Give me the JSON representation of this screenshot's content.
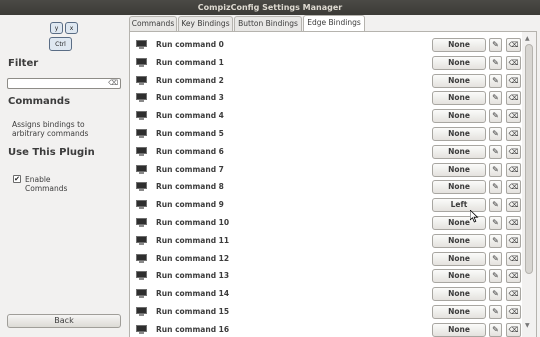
{
  "window": {
    "title": "CompizConfig Settings Manager"
  },
  "sidebar": {
    "logo_keys": [
      "y",
      "x",
      "Ctrl"
    ],
    "filter_heading": "Filter",
    "filter_value": "",
    "commands_heading": "Commands",
    "description": "Assigns bindings to arbitrary commands",
    "use_plugin_heading": "Use This Plugin",
    "enable_label": "Enable Commands",
    "enable_checked": "✔",
    "back_label": "Back"
  },
  "tabs": [
    "Commands",
    "Key Bindings",
    "Button Bindings",
    "Edge Bindings"
  ],
  "active_tab": "Edge Bindings",
  "rows": [
    {
      "name": "Run command 0",
      "value": "None"
    },
    {
      "name": "Run command 1",
      "value": "None"
    },
    {
      "name": "Run command 2",
      "value": "None"
    },
    {
      "name": "Run command 3",
      "value": "None"
    },
    {
      "name": "Run command 4",
      "value": "None"
    },
    {
      "name": "Run command 5",
      "value": "None"
    },
    {
      "name": "Run command 6",
      "value": "None"
    },
    {
      "name": "Run command 7",
      "value": "None"
    },
    {
      "name": "Run command 8",
      "value": "None"
    },
    {
      "name": "Run command 9",
      "value": "Left"
    },
    {
      "name": "Run command 10",
      "value": "None"
    },
    {
      "name": "Run command 11",
      "value": "None"
    },
    {
      "name": "Run command 12",
      "value": "None"
    },
    {
      "name": "Run command 13",
      "value": "None"
    },
    {
      "name": "Run command 14",
      "value": "None"
    },
    {
      "name": "Run command 15",
      "value": "None"
    },
    {
      "name": "Run command 16",
      "value": "None"
    }
  ],
  "icons": {
    "edit": "pencil-icon",
    "clear": "clear-icon",
    "row": "monitor-icon"
  },
  "colors": {
    "titlebar": "#3c3b37",
    "panel": "#ffffff",
    "window_bg": "#f2f1f0"
  }
}
